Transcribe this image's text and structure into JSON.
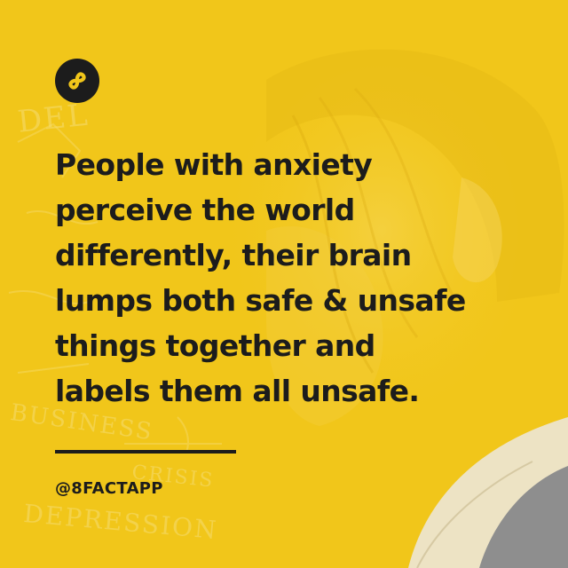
{
  "brand": {
    "logo_icon": "infinity-eight-icon",
    "handle": "@8FACTAPP"
  },
  "fact": {
    "lines": [
      "People with anxiety",
      "perceive the world",
      "differently, their brain",
      "lumps both safe & unsafe",
      "things together and",
      "labels them all unsafe."
    ]
  },
  "colors": {
    "background": "#f1c61a",
    "text": "#1c1c1c",
    "logo": "#1c1c1c"
  }
}
